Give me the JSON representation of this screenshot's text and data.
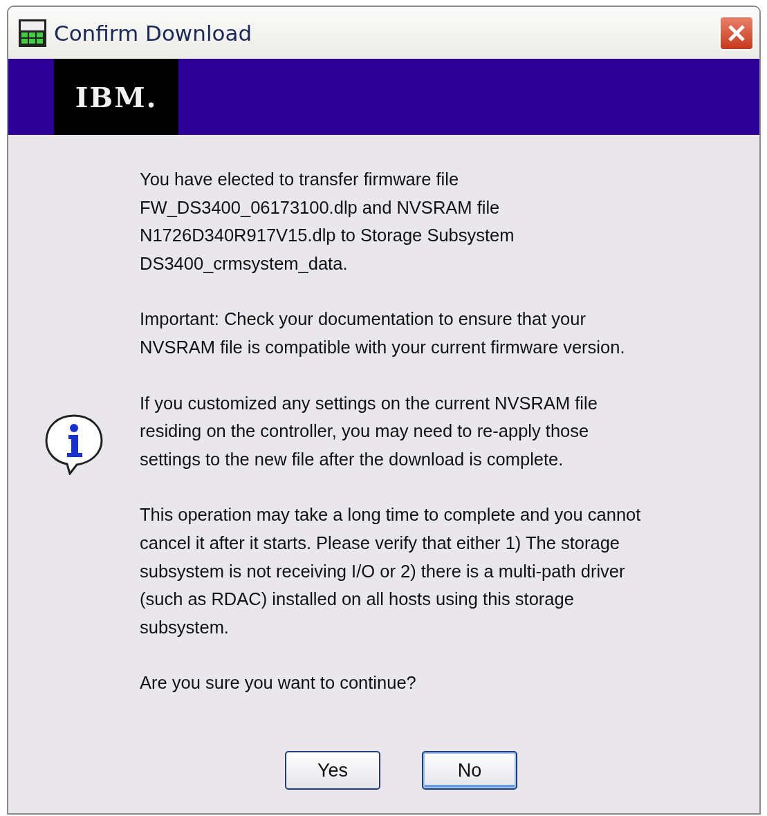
{
  "window": {
    "title": "Confirm Download"
  },
  "banner": {
    "logo": "IBM."
  },
  "paragraphs": [
    {
      "lines": [
        "You have elected to transfer firmware file",
        "FW_DS3400_06173100.dlp and NVSRAM file",
        "N1726D340R917V15.dlp to Storage Subsystem",
        "DS3400_crmsystem_data."
      ]
    },
    {
      "lines": [
        "Important: Check your documentation to ensure that your",
        "NVSRAM file is compatible with your current firmware version."
      ]
    },
    {
      "lines": [
        "If you customized any settings on the current NVSRAM file",
        "residing on the controller, you may need to re-apply those",
        "settings to the new file after the download is complete."
      ]
    },
    {
      "lines": [
        "This operation may take a long time to complete and you cannot",
        "cancel it after it starts. Please verify that either 1) The storage",
        "subsystem is not receiving I/O or 2) there is a multi-path driver",
        "(such as RDAC) installed on all hosts using this storage",
        "subsystem."
      ]
    },
    {
      "lines": [
        "Are you sure you want to continue?"
      ]
    }
  ],
  "buttons": [
    {
      "label": "Yes",
      "focused": false
    },
    {
      "label": "No",
      "focused": true
    }
  ]
}
